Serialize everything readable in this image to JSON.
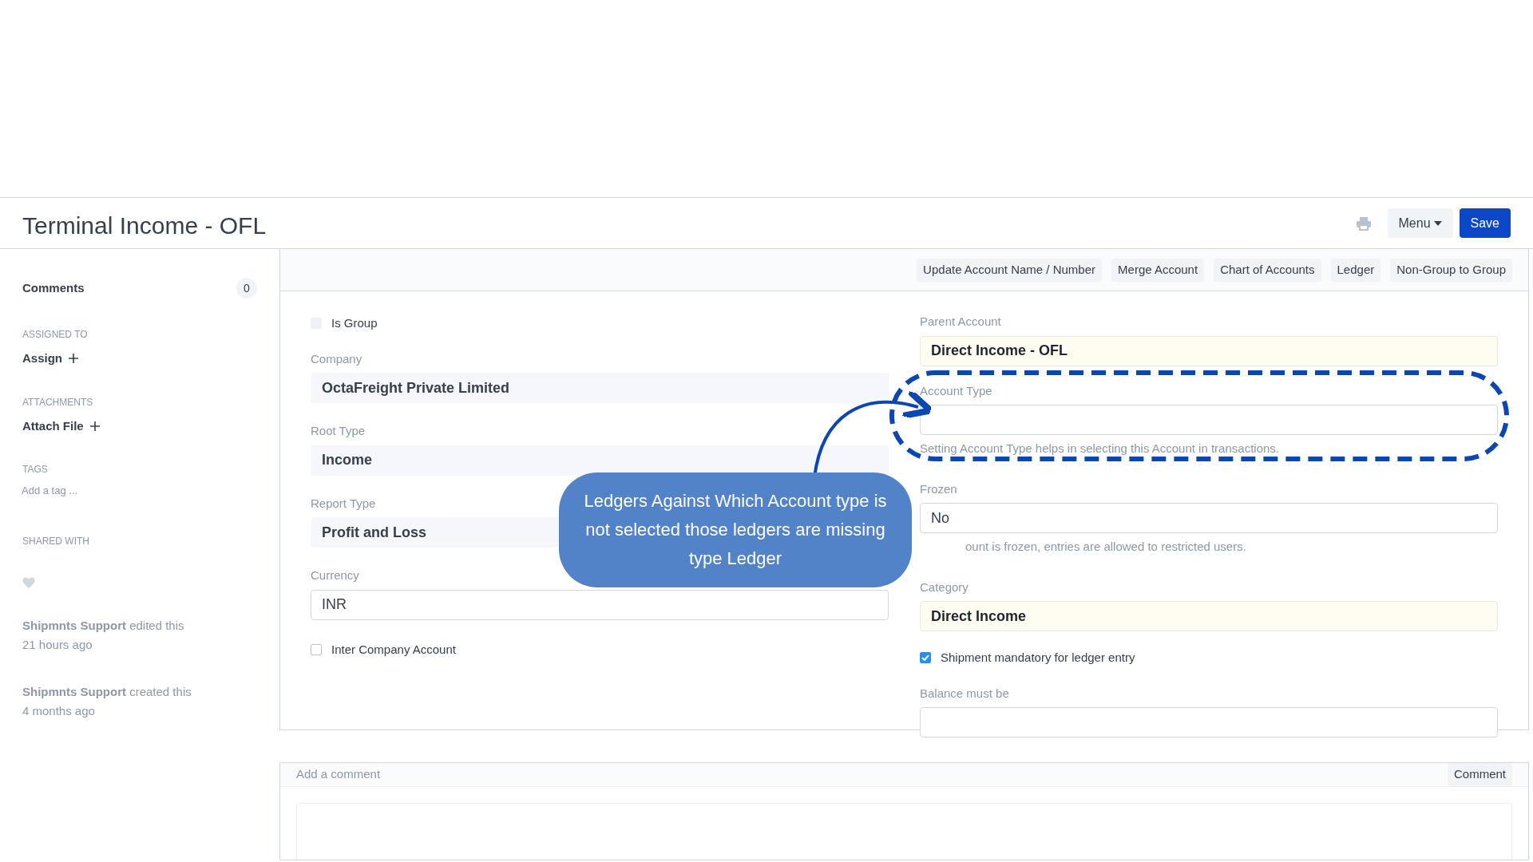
{
  "page": {
    "title": "Terminal Income - OFL"
  },
  "toolbar": {
    "menu": "Menu",
    "save": "Save"
  },
  "sidebar": {
    "comments": {
      "label": "Comments",
      "count": "0"
    },
    "assigned": {
      "heading": "ASSIGNED TO",
      "action": "Assign"
    },
    "attachments": {
      "heading": "ATTACHMENTS",
      "action": "Attach File"
    },
    "tags": {
      "heading": "TAGS",
      "placeholder": "Add a tag ..."
    },
    "shared": {
      "heading": "SHARED WITH"
    },
    "activity": [
      {
        "text": "**Shipmnts Support** edited this",
        "time": "21 hours ago"
      },
      {
        "text": "**Shipmnts Support** created this",
        "time": "4 months ago"
      }
    ]
  },
  "actions": [
    "Update Account Name / Number",
    "Merge Account",
    "Chart of Accounts",
    "Ledger",
    "Non-Group to Group"
  ],
  "form": {
    "left": [
      {
        "kind": "checkbox",
        "label": "Is Group",
        "checked": false,
        "disabled": true
      },
      {
        "kind": "readonly",
        "label": "Company",
        "value": "OctaFreight Private Limited"
      },
      {
        "kind": "readonly",
        "label": "Root Type",
        "value": "Income"
      },
      {
        "kind": "readonly",
        "label": "Report Type",
        "value": "Profit and Loss"
      },
      {
        "kind": "input",
        "label": "Currency",
        "value": "INR"
      },
      {
        "kind": "checkbox",
        "label": "Inter Company Account",
        "checked": false,
        "disabled": false
      }
    ],
    "right": [
      {
        "kind": "link",
        "label": "Parent Account",
        "value": "Direct Income - OFL"
      },
      {
        "kind": "input",
        "label": "Account Type",
        "description": "Setting Account Type helps in selecting this Account in transactions."
      },
      {
        "kind": "input",
        "label": "Frozen",
        "value": "No",
        "description": "ount is frozen, entries are allowed to restricted users."
      },
      {
        "kind": "link",
        "label": "Category",
        "value": "Direct Income"
      },
      {
        "kind": "checkbox",
        "label": "Shipment mandatory for ledger entry",
        "checked": true
      },
      {
        "kind": "input",
        "label": "Balance must be"
      }
    ]
  },
  "comment": {
    "placeholder": "Add a comment",
    "button": "Comment"
  },
  "annotation": {
    "text": "Ledgers Against Which Account type is not selected those ledgers are missing type Ledger"
  }
}
